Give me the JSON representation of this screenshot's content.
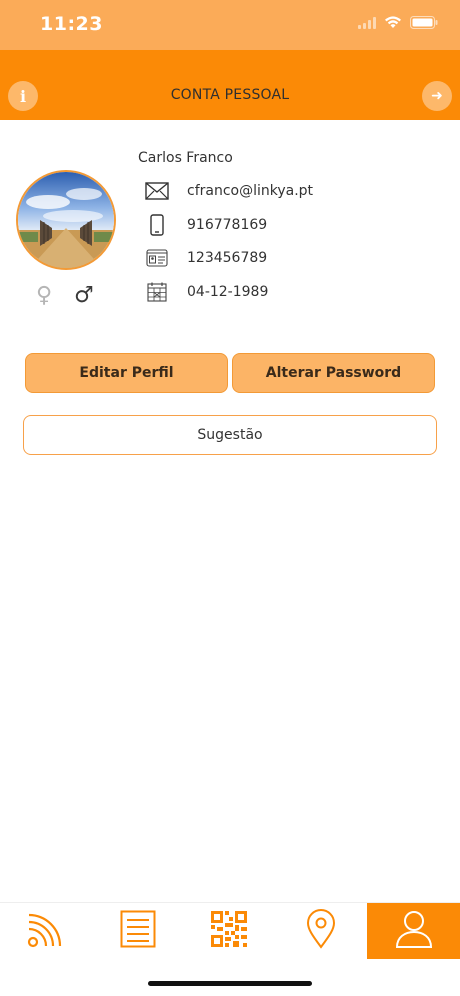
{
  "status_bar": {
    "time": "11:23"
  },
  "header": {
    "title": "CONTA PESSOAL",
    "info_icon": "i",
    "logout_icon": "➜"
  },
  "profile": {
    "name": "Carlos Franco",
    "email": "cfranco@linkya.pt",
    "phone": "916778169",
    "id_number": "123456789",
    "birth_date": "04-12-1989",
    "gender_options": [
      "♀",
      "♂"
    ],
    "selected_gender": "male"
  },
  "actions": {
    "edit_label": "Editar Perfil",
    "password_label": "Alterar Password",
    "suggestion_label": "Sugestão"
  },
  "tabs": [
    {
      "name": "feed",
      "icon": "rss-icon"
    },
    {
      "name": "list",
      "icon": "list-icon"
    },
    {
      "name": "qrcode",
      "icon": "qr-code-icon"
    },
    {
      "name": "location",
      "icon": "location-pin-icon"
    },
    {
      "name": "account",
      "icon": "user-icon",
      "active": true
    }
  ],
  "colors": {
    "accent": "#fb8a06",
    "status_bar": "#fbab58",
    "button": "#fcb466"
  }
}
